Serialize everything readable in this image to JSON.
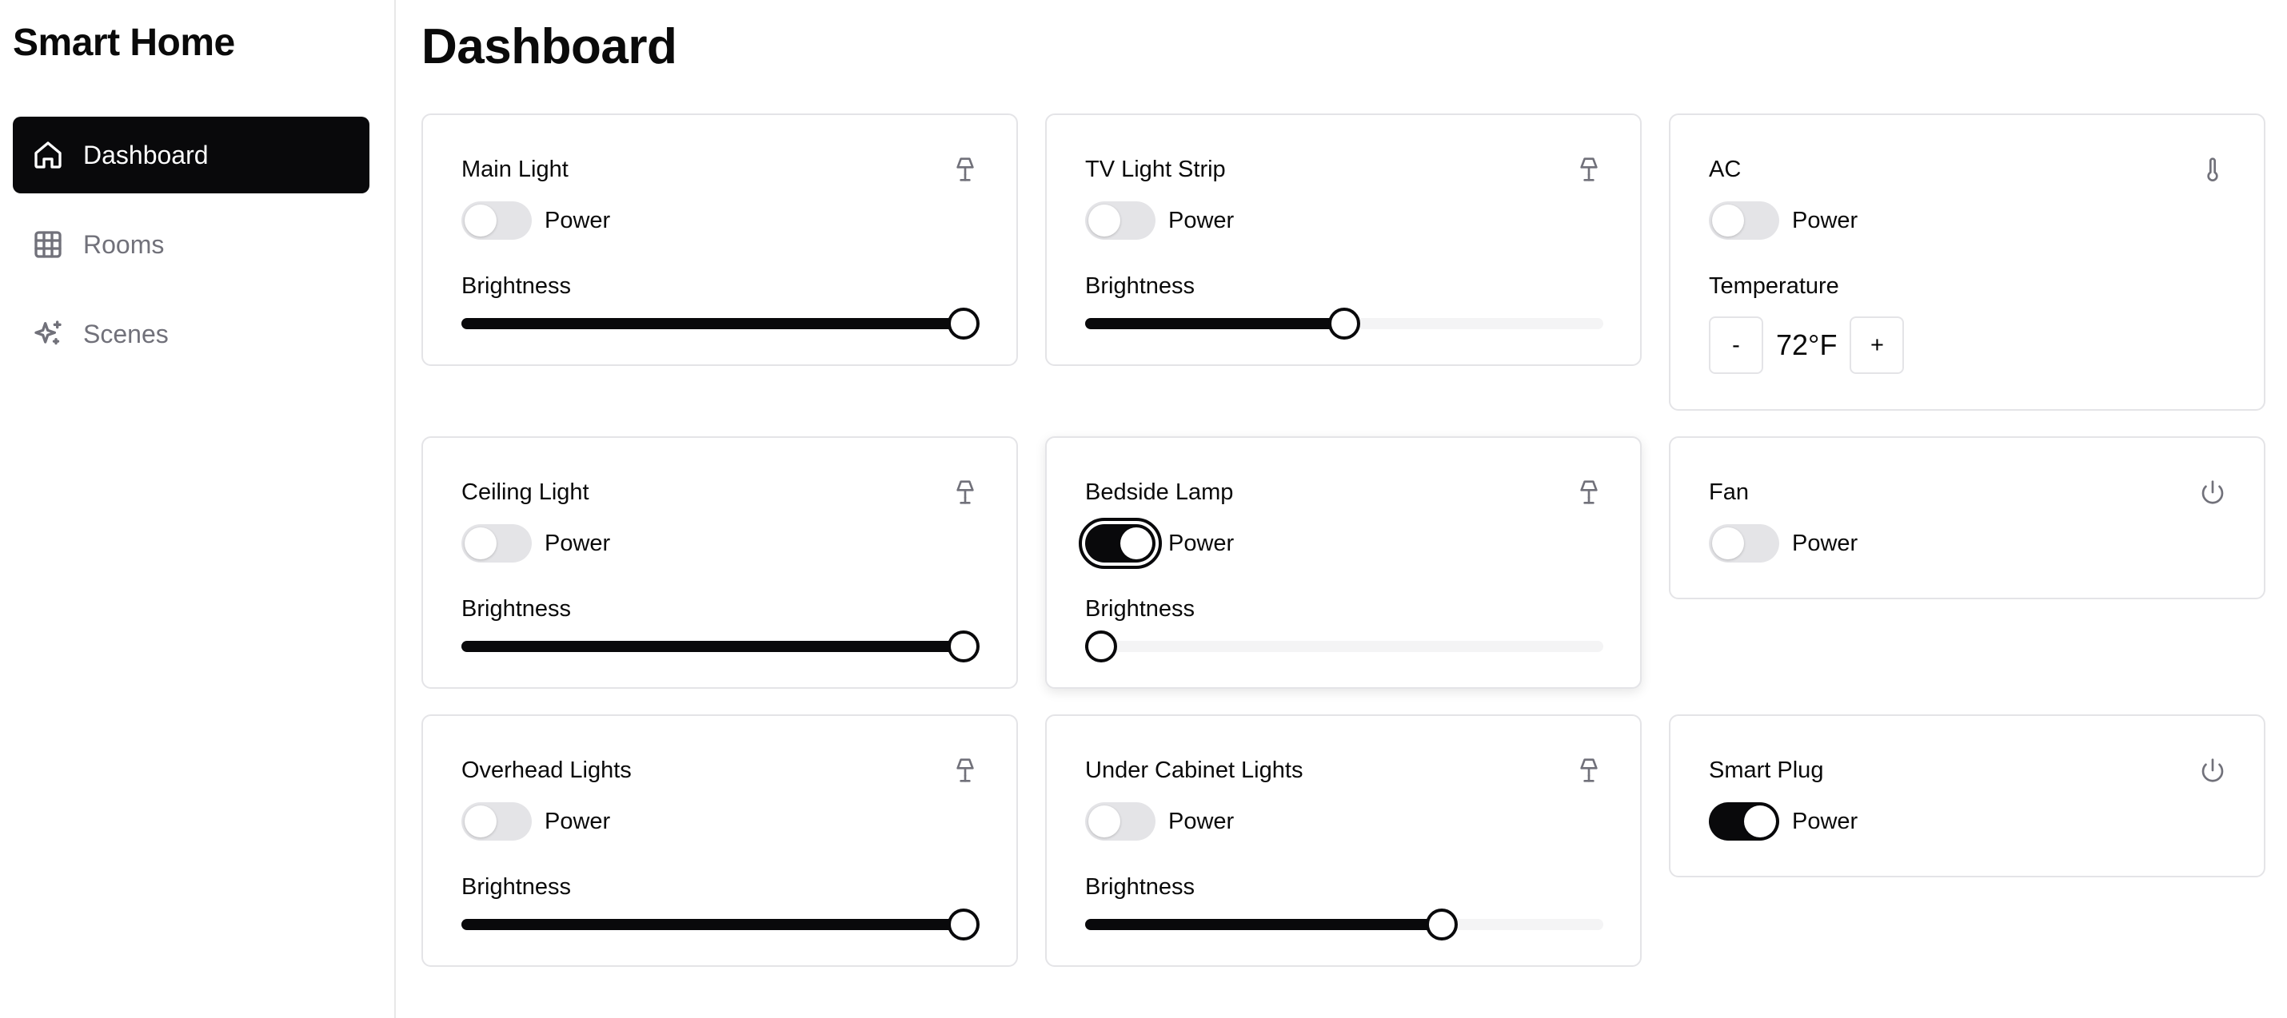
{
  "sidebar": {
    "brand": "Smart Home",
    "items": [
      {
        "label": "Dashboard",
        "icon": "home-icon",
        "active": true
      },
      {
        "label": "Rooms",
        "icon": "grid-icon",
        "active": false
      },
      {
        "label": "Scenes",
        "icon": "sparkles-icon",
        "active": false
      }
    ]
  },
  "main": {
    "title": "Dashboard",
    "power_label": "Power",
    "brightness_label": "Brightness",
    "temperature_label": "Temperature",
    "devices": [
      {
        "name": "Main Light",
        "icon": "lamp-icon",
        "power": false,
        "brightness": 100
      },
      {
        "name": "TV Light Strip",
        "icon": "lamp-icon",
        "power": false,
        "brightness": 50
      },
      {
        "name": "AC",
        "icon": "thermometer-icon",
        "power": false,
        "temperature": "72°F",
        "decrease": "-",
        "increase": "+"
      },
      {
        "name": "Ceiling Light",
        "icon": "lamp-icon",
        "power": false,
        "brightness": 100
      },
      {
        "name": "Bedside Lamp",
        "icon": "lamp-icon",
        "power": true,
        "brightness": 0
      },
      {
        "name": "Fan",
        "icon": "power-icon",
        "power": false
      },
      {
        "name": "Overhead Lights",
        "icon": "lamp-icon",
        "power": false,
        "brightness": 100
      },
      {
        "name": "Under Cabinet Lights",
        "icon": "lamp-icon",
        "power": false,
        "brightness": 70
      },
      {
        "name": "Smart Plug",
        "icon": "power-icon",
        "power": true
      }
    ]
  },
  "colors": {
    "accent": "#09090b",
    "border": "#e4e4e7",
    "muted_text": "#71717a",
    "track": "#f4f4f5"
  }
}
